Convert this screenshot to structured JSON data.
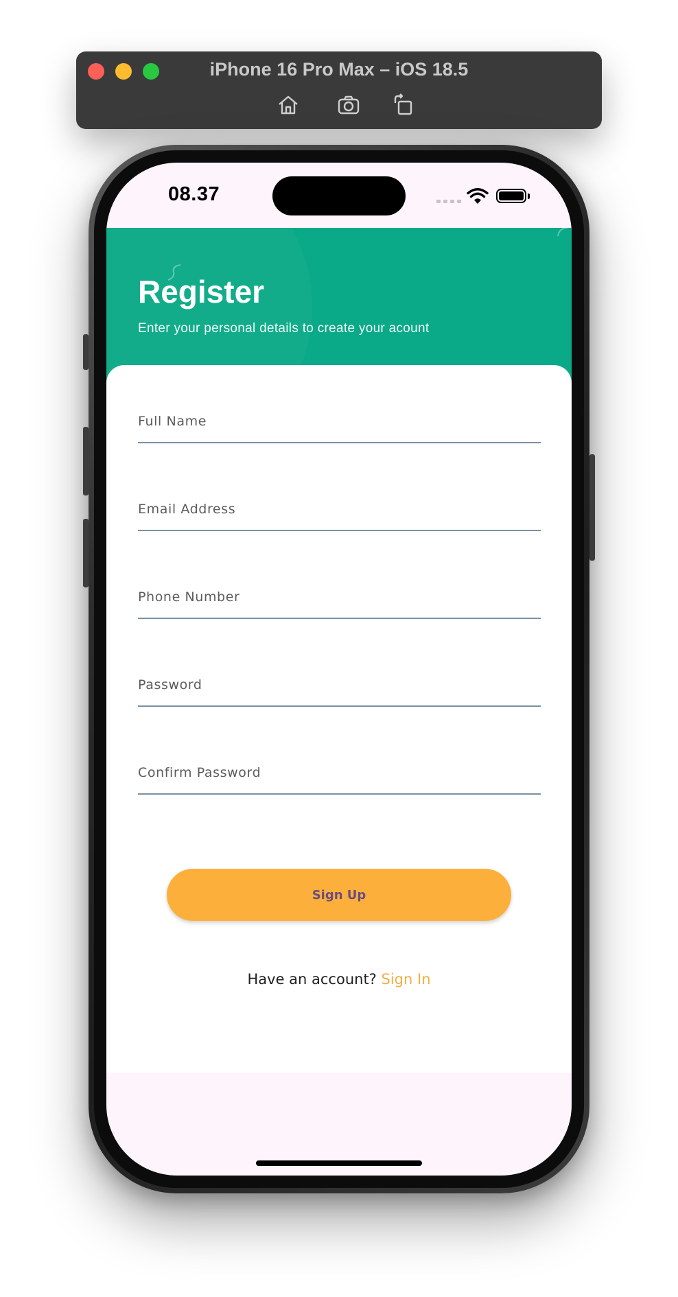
{
  "simulator": {
    "title": "iPhone 16 Pro Max – iOS 18.5",
    "toolbar": [
      "home-icon",
      "screenshot-icon",
      "rotate-icon"
    ]
  },
  "status_bar": {
    "time": "08.37"
  },
  "header": {
    "title": "Register",
    "subtitle": "Enter your personal details to create your acount",
    "background_color": "#0aa987"
  },
  "form": {
    "fields": [
      {
        "placeholder": "Full Name"
      },
      {
        "placeholder": "Email Address"
      },
      {
        "placeholder": "Phone Number"
      },
      {
        "placeholder": "Password"
      },
      {
        "placeholder": "Confirm Password"
      }
    ],
    "signup_label": "Sign Up",
    "signup_color": "#fdaf3c"
  },
  "footer": {
    "prompt": "Have an account?",
    "signin_label": "Sign In",
    "signin_color": "#f4ae3f"
  }
}
